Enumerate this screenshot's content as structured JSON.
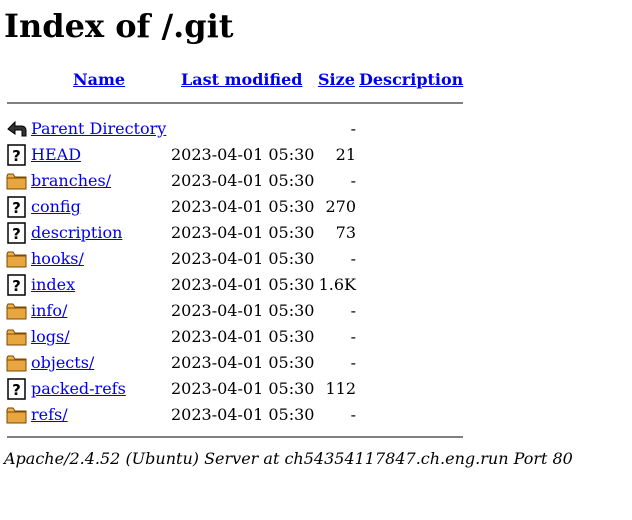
{
  "page": {
    "title": "Index of /.git"
  },
  "columns": {
    "name": "Name",
    "last_modified": "Last modified",
    "size": "Size",
    "description": "Description"
  },
  "entries": [
    {
      "name": "Parent Directory",
      "modified": "",
      "size": "-",
      "description": "",
      "icon": "back-icon"
    },
    {
      "name": "HEAD",
      "modified": "2023-04-01 05:30",
      "size": "21",
      "description": "",
      "icon": "unknown-file-icon"
    },
    {
      "name": "branches/",
      "modified": "2023-04-01 05:30",
      "size": "-",
      "description": "",
      "icon": "folder-icon"
    },
    {
      "name": "config",
      "modified": "2023-04-01 05:30",
      "size": "270",
      "description": "",
      "icon": "unknown-file-icon"
    },
    {
      "name": "description",
      "modified": "2023-04-01 05:30",
      "size": "73",
      "description": "",
      "icon": "unknown-file-icon"
    },
    {
      "name": "hooks/",
      "modified": "2023-04-01 05:30",
      "size": "-",
      "description": "",
      "icon": "folder-icon"
    },
    {
      "name": "index",
      "modified": "2023-04-01 05:30",
      "size": "1.6K",
      "description": "",
      "icon": "unknown-file-icon"
    },
    {
      "name": "info/",
      "modified": "2023-04-01 05:30",
      "size": "-",
      "description": "",
      "icon": "folder-icon"
    },
    {
      "name": "logs/",
      "modified": "2023-04-01 05:30",
      "size": "-",
      "description": "",
      "icon": "folder-icon"
    },
    {
      "name": "objects/",
      "modified": "2023-04-01 05:30",
      "size": "-",
      "description": "",
      "icon": "folder-icon"
    },
    {
      "name": "packed-refs",
      "modified": "2023-04-01 05:30",
      "size": "112",
      "description": "",
      "icon": "unknown-file-icon"
    },
    {
      "name": "refs/",
      "modified": "2023-04-01 05:30",
      "size": "-",
      "description": "",
      "icon": "folder-icon"
    }
  ],
  "footer": {
    "server_signature": "Apache/2.4.52 (Ubuntu) Server at ch54354117847.ch.eng.run Port 80"
  },
  "colors": {
    "link": "#0000ee",
    "rule": "#808080",
    "folder_fill": "#f0b050",
    "folder_stroke": "#7a4a00"
  }
}
